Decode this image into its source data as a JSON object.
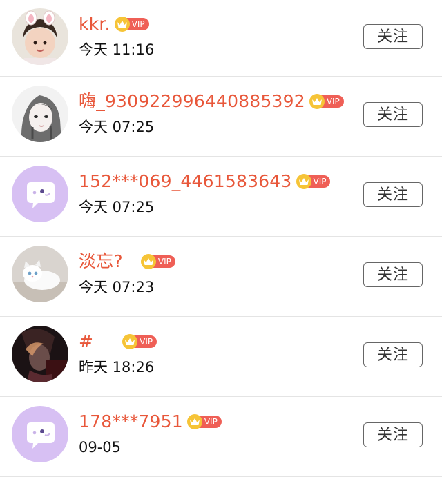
{
  "follow_list": {
    "follow_label": "关注",
    "vip_label": "VIP",
    "items": [
      {
        "username": "kkr.",
        "time": "今天 11:16",
        "avatar": "girl-photo"
      },
      {
        "username": "嗨_930922996440885392",
        "time": "今天 07:25",
        "avatar": "sketch-girl"
      },
      {
        "username": "152***069_4461583643",
        "time": "今天 07:25",
        "avatar": "default-chat-bubble"
      },
      {
        "username": "淡忘?",
        "time": "今天 07:23",
        "avatar": "kitten-photo"
      },
      {
        "username": "#",
        "time": "昨天 18:26",
        "avatar": "dark-portrait"
      },
      {
        "username": "178***7951",
        "time": "09-05",
        "avatar": "default-chat-bubble"
      }
    ]
  },
  "colors": {
    "username": "#e8573a",
    "vip_badge": "#ef5f56",
    "vip_crown": "#f6c437",
    "default_avatar_bg": "#d7c0f3",
    "divider": "#e4e4e4"
  }
}
